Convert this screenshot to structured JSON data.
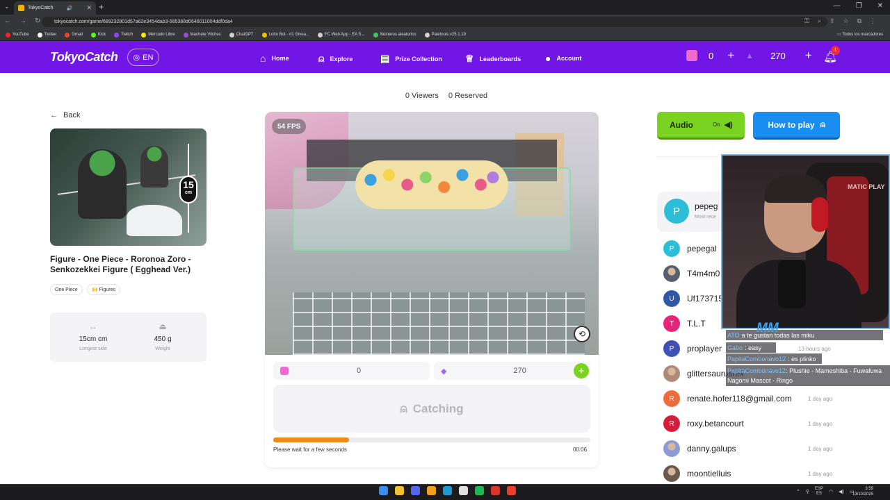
{
  "browser": {
    "tab_title": "TokyoCatch",
    "tab_close": "✕",
    "new_tab": "+",
    "url": "tokyocatch.com/game/689232801d57a62e3454dab3-685388d0646011004ddf0da4",
    "window_controls": [
      "—",
      "❐",
      "✕"
    ],
    "bookmarks": [
      "YouTube",
      "Twitter",
      "Gmail",
      "Kick",
      "Twitch",
      "Mercado Libre",
      "Machete Vilches",
      "ChatGPT",
      "Lotto Bot - #1 Givea...",
      "FC Web App - EA S...",
      "Números aleatorios",
      "Paletools v25.1.19"
    ],
    "bookmark_colors": [
      "#ff2020",
      "#ffffff",
      "#ea4335",
      "#53fc18",
      "#9146ff",
      "#ffe600",
      "#9a4fd0",
      "#cfcfcf",
      "#f5c400",
      "#d0d0d0",
      "#47c25f",
      "#d0d0d0"
    ],
    "all_bookmarks": "Todos los marcadores"
  },
  "header": {
    "logo": "TokyoCatch",
    "lang": "EN",
    "nav": [
      {
        "label": "Home",
        "icon": "home-icon"
      },
      {
        "label": "Explore",
        "icon": "claw-icon"
      },
      {
        "label": "Prize Collection",
        "icon": "collection-icon"
      },
      {
        "label": "Leaderboards",
        "icon": "trophy-icon"
      },
      {
        "label": "Account",
        "icon": "user-icon"
      }
    ],
    "tickets": "0",
    "gems": "270",
    "plus": "+",
    "notifications": "1",
    "ticket_color": "#f06bd0",
    "gem_color": "#9b6bf0"
  },
  "main": {
    "viewers": "0 Viewers",
    "reserved": "0 Reserved",
    "back": "Back",
    "size_value": "15",
    "size_unit": "cm",
    "product_title": "Figure - One Piece - Roronoa Zoro - Senkozekkei Figure ( Egghead Ver.)",
    "tags": [
      "One Piece",
      "🙌 Figures"
    ],
    "specs": [
      {
        "value": "15cm cm",
        "label": "Longest side",
        "icon": "ruler-icon"
      },
      {
        "value": "450 g",
        "label": "Weight",
        "icon": "weight-icon"
      }
    ]
  },
  "game": {
    "fps": "54 FPS",
    "ticket_balance": "0",
    "gem_balance": "270",
    "catch_label": "Catching",
    "progress": 0.24,
    "wait_text": "Please wait for a few seconds",
    "timer": "00:06",
    "accent": "#f08a18"
  },
  "sidebar": {
    "audio_label": "Audio",
    "audio_state": "On",
    "how_label": "How to play",
    "featured": {
      "initial": "P",
      "name": "pepeg",
      "sub": "Most rece"
    },
    "leaderboard": [
      {
        "initial": "P",
        "name": "pepegal",
        "time": "",
        "color": "#2cbdd8",
        "photo": false
      },
      {
        "initial": "",
        "name": "T4m4m0",
        "time": "",
        "color": "#556070",
        "photo": true
      },
      {
        "initial": "U",
        "name": "Uf173715",
        "time": "",
        "color": "#2f57a8",
        "photo": false
      },
      {
        "initial": "T",
        "name": "T.L.T",
        "time": "",
        "color": "#e8237a",
        "photo": false
      },
      {
        "initial": "P",
        "name": "proplayer",
        "time": "13 hours ago",
        "color": "#3f51b5",
        "photo": false
      },
      {
        "initial": "",
        "name": "glittersaurusrex",
        "time": "",
        "color": "#b08a78",
        "photo": true
      },
      {
        "initial": "R",
        "name": "renate.hofer118@gmail.com",
        "time": "1 day ago",
        "color": "#f06b3c",
        "photo": false
      },
      {
        "initial": "R",
        "name": "roxy.betancourt",
        "time": "1 day ago",
        "color": "#d61c3a",
        "photo": false
      },
      {
        "initial": "",
        "name": "danny.galups",
        "time": "1 day ago",
        "color": "#8c9ad8",
        "photo": true
      },
      {
        "initial": "",
        "name": "moontielluis",
        "time": "1 day ago",
        "color": "#6a5a4a",
        "photo": true
      }
    ]
  },
  "stream": {
    "brand": "MATIC PLAY",
    "logo": "MM",
    "chat": [
      {
        "user": "ATO",
        "text": "a te gustan todas las miku"
      },
      {
        "user": "Gabo",
        "text": ": easy"
      },
      {
        "user": "PapitaCombonavo12",
        "text": ": es plinko"
      }
    ],
    "chat_long_user": "PapitaCombonavo12",
    "chat_long_text": ": Plushie - Mameshiba - Fuwafuwa Nagomi Mascot - Ringo"
  },
  "taskbar": {
    "icons": [
      "#3a8ef0",
      "#f2c230",
      "#5865f2",
      "#f0a020",
      "#1b9bd1",
      "#e0e0e0",
      "#1db954",
      "#d9362a",
      "#e8402a"
    ],
    "lang": "ESP",
    "region": "ES",
    "time": "3:59",
    "date": "13/10/2025"
  }
}
